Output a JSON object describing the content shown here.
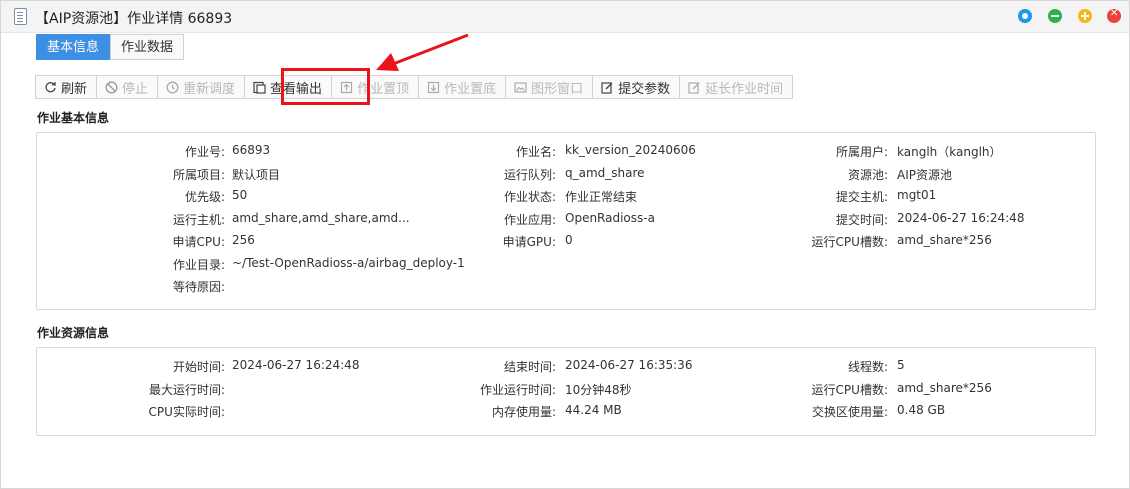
{
  "window": {
    "title": "【AIP资源池】作业详情 66893",
    "controls": [
      "restore",
      "minimize",
      "maximize",
      "close"
    ]
  },
  "tabs": [
    {
      "label": "基本信息",
      "active": true
    },
    {
      "label": "作业数据",
      "active": false
    }
  ],
  "toolbar": [
    {
      "label": "刷新",
      "icon": "refresh-icon",
      "enabled": true
    },
    {
      "label": "停止",
      "icon": "stop-icon",
      "enabled": false
    },
    {
      "label": "重新调度",
      "icon": "reschedule-icon",
      "enabled": false
    },
    {
      "label": "查看输出",
      "icon": "output-icon",
      "enabled": true
    },
    {
      "label": "作业置顶",
      "icon": "pin-top-icon",
      "enabled": false
    },
    {
      "label": "作业置底",
      "icon": "pin-bottom-icon",
      "enabled": false
    },
    {
      "label": "图形窗口",
      "icon": "graphics-window-icon",
      "enabled": false
    },
    {
      "label": "提交参数",
      "icon": "edit-icon",
      "enabled": true
    },
    {
      "label": "延长作业时间",
      "icon": "extend-time-icon",
      "enabled": false
    }
  ],
  "basic": {
    "title": "作业基本信息",
    "rows": [
      [
        {
          "k": "作业号:",
          "v": "66893"
        },
        {
          "k": "作业名:",
          "v": "kk_version_20240606"
        },
        {
          "k": "所属用户:",
          "v": "kanglh（kanglh）"
        }
      ],
      [
        {
          "k": "所属项目:",
          "v": "默认项目"
        },
        {
          "k": "运行队列:",
          "v": "q_amd_share"
        },
        {
          "k": "资源池:",
          "v": "AIP资源池"
        }
      ],
      [
        {
          "k": "优先级:",
          "v": "50"
        },
        {
          "k": "作业状态:",
          "v": "作业正常结束"
        },
        {
          "k": "提交主机:",
          "v": "mgt01"
        }
      ],
      [
        {
          "k": "运行主机:",
          "v": "amd_share,amd_share,amd..."
        },
        {
          "k": "作业应用:",
          "v": "OpenRadioss-a"
        },
        {
          "k": "提交时间:",
          "v": "2024-06-27 16:24:48"
        }
      ],
      [
        {
          "k": "申请CPU:",
          "v": "256"
        },
        {
          "k": "申请GPU:",
          "v": "0"
        },
        {
          "k": "运行CPU槽数:",
          "v": "amd_share*256"
        }
      ],
      [
        {
          "k": "作业目录:",
          "v": "~/Test-OpenRadioss-a/airbag_deploy-1"
        }
      ],
      [
        {
          "k": "等待原因:",
          "v": ""
        }
      ]
    ]
  },
  "resource": {
    "title": "作业资源信息",
    "rows": [
      [
        {
          "k": "开始时间:",
          "v": "2024-06-27 16:24:48"
        },
        {
          "k": "结束时间:",
          "v": "2024-06-27 16:35:36"
        },
        {
          "k": "线程数:",
          "v": "5"
        }
      ],
      [
        {
          "k": "最大运行时间:",
          "v": ""
        },
        {
          "k": "作业运行时间:",
          "v": "10分钟48秒"
        },
        {
          "k": "运行CPU槽数:",
          "v": "amd_share*256"
        }
      ],
      [
        {
          "k": "CPU实际时间:",
          "v": ""
        },
        {
          "k": "内存使用量:",
          "v": "44.24 MB"
        },
        {
          "k": "交换区使用量:",
          "v": "0.48 GB"
        }
      ]
    ]
  },
  "colors": {
    "accent": "#3d8fe4",
    "highlight": "#e8131b"
  }
}
